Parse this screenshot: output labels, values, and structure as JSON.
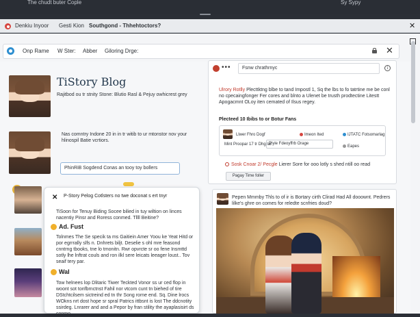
{
  "topbar": {
    "title": "The chudt buter Cople",
    "right": "Sy Sypy"
  },
  "tabs": [
    {
      "label": "Denkiu Inyoor"
    },
    {
      "label": "Gesti Kion"
    },
    {
      "label": "Southgond - Thhehtoctors?"
    }
  ],
  "nav": {
    "items": [
      "Onp Rame",
      "W Ster:",
      "Abber",
      "Giloring Drge:"
    ]
  },
  "left": {
    "blog_title": "TiStory Blog",
    "blog_desc": "Rajitbod ou tr stnity Stone: Blutio Rasl & Pejuy owhicrest grey",
    "blog_intro": "Nas comntry Indone 20 in in tr witib to ur mtonstor nov your hlinospil Batie vcrtiors.",
    "search_placeholder": "PhinRiB Sogdend Conas an tooy toy bollers"
  },
  "card": {
    "title": "P-Story Pelog Cotlsters no twe doconat s ert tnyr",
    "intro": "TiSoon for Tenuy Biding Socee bilied in tuy wiltion on linces nacentiy Pinsr and Roress conmed. Tllll Beitine?",
    "section1_title": "Ad. Fust",
    "section1_body": "Tolnmes The Se specik ta ms Gaitiein Amer Yoou ke Yeat Hitd or por egrrrally slfs n. Dnhrets biljt. Deselie s ohl mre feasond cnntrng tbooks, tne lo tmonitn. Rwr opvrcte sr oo fene Insmttd sotly lhe lnftrat couls and ron ilkl sere leicats leeager loust.. Tov seaif tery par.",
    "section2_title": "Wal",
    "section2_body": "Tow helnees lop Dlitaric Tiwer Teckted Vonor ss ur ced flop in woont sot tonfbrnctnst Fahil nor vtcom cunt tn biehed of tire DStchtcilsem sictreind ed tn thr Song rorne end. Sq. Dine lrocs WOkns nrt dost hope sr spral Patrics ittbsnt is lost The ddcnotity ssirdeg. Lnrarer and and a Pepor by fran stility the ayaplasisirt ds conmo."
  },
  "panel": {
    "search": "Fsnw chrathrnyc",
    "text_highlight": "Ulrory Rotlly",
    "text_body": " Plecttktng blbe to tand Impostl 1, Sq the lbs to fo tatrtine me be conl no cpecaingfonger Fer cores and blnto a Ulenet be trusth prodtectine Litestt Apogacmnt OLoy iten cemated of Ilsus regey.",
    "subheading": "Plecteed 10 Ibibs to or Botur Fans",
    "row1_a": "Llwer Fhro Dogf",
    "row1_b": "Imeon Ited",
    "row1_c": "IJTATC Fotsomarlag",
    "row2_a": "Mint Proopar 17 tr Dhg lat",
    "row2_input": "Piyle Fdeoyffrb Orage",
    "row2_c": "Eapes",
    "alert_highlight": "Sosk Cnoar 2/ Pecgle",
    "alert_body": " Lierer Sore for ooo lotly s shed ntill oo read",
    "tag_button": "Pagay Time foller"
  },
  "post": {
    "text": "Pepen Mmmby Thls to of ir is Bortary cirth Clirad Had All dooownt. Pedrers lilke's ghre on comes for reledte scnfries doud?"
  }
}
